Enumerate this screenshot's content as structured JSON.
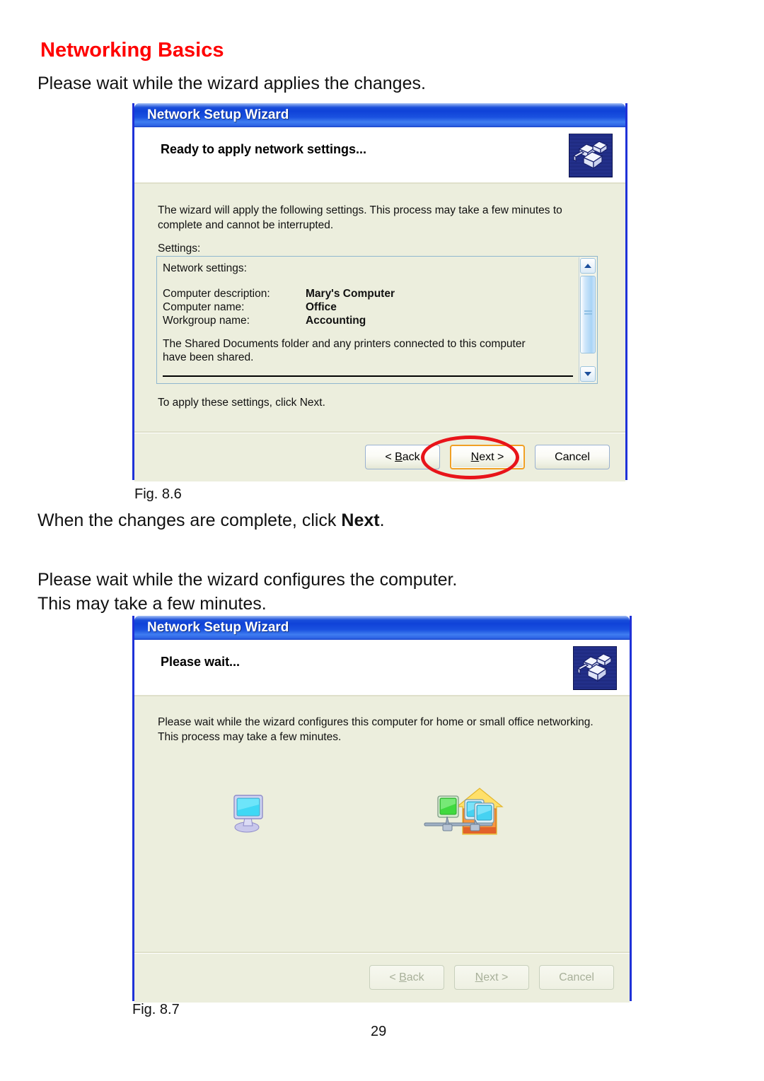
{
  "document": {
    "heading": "Networking Basics",
    "intro_1": "Please wait while the wizard applies the changes.",
    "between_text_prefix": "When the changes are complete, click ",
    "between_text_bold": "Next",
    "between_text_suffix": ".",
    "intro_2_line1": "Please wait while the wizard configures the computer.",
    "intro_2_line2": "This may take a few minutes.",
    "figure_1_caption": "Fig. 8.6",
    "figure_2_caption": "Fig. 8.7",
    "page_number": "29",
    "heading_color": "#ff0000"
  },
  "dialog1": {
    "title": "Network Setup Wizard",
    "header_title": "Ready to apply network settings...",
    "header_icon": "network-setup-wizard-icon",
    "body_paragraph": "The wizard will apply the following settings. This process may take a few minutes to complete and cannot be interrupted.",
    "settings_label": "Settings:",
    "listbox": {
      "section_title": "Network settings:",
      "rows": [
        {
          "key": "Computer description:",
          "value": "Mary's Computer"
        },
        {
          "key": "Computer name:",
          "value": "Office"
        },
        {
          "key": "Workgroup name:",
          "value": "Accounting"
        }
      ],
      "note": "The Shared Documents folder and any printers connected to this computer have been shared.",
      "scrollbar": {
        "up_icon": "chevron-up-icon",
        "down_icon": "chevron-down-icon"
      }
    },
    "apply_hint": "To apply these settings, click Next.",
    "buttons": [
      {
        "label": "< Back",
        "underline_char": "B",
        "state": "enabled",
        "default": false
      },
      {
        "label": "Next >",
        "underline_char": "N",
        "state": "enabled",
        "default": true
      },
      {
        "label": "Cancel",
        "underline_char": "",
        "state": "enabled",
        "default": false
      }
    ],
    "annotation": {
      "type": "red-ellipse-highlight",
      "target": "Next >",
      "color": "#e8141a"
    }
  },
  "dialog2": {
    "title": "Network Setup Wizard",
    "header_title": "Please wait...",
    "header_icon": "network-setup-wizard-icon",
    "body_paragraph": "Please wait while the wizard configures this computer for home or small office networking. This process may take a few minutes.",
    "animation": {
      "left_icon": "computer-monitor-icon",
      "right_icon": "home-network-icon"
    },
    "buttons": [
      {
        "label": "< Back",
        "underline_char": "B",
        "state": "disabled",
        "default": false
      },
      {
        "label": "Next >",
        "underline_char": "N",
        "state": "disabled",
        "default": false
      },
      {
        "label": "Cancel",
        "underline_char": "",
        "state": "disabled",
        "default": false
      }
    ]
  },
  "theme": {
    "titlebar_blue": "#1f56dd",
    "dialog_border": "#1f32d8",
    "body_beige": "#eceedd",
    "default_button_orange": "#f0a024"
  }
}
